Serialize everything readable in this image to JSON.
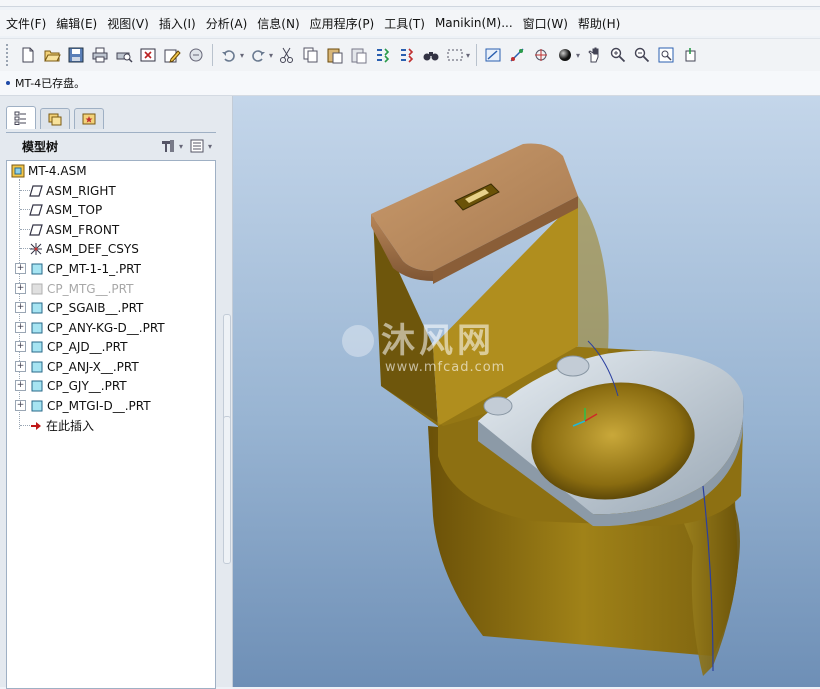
{
  "menubar": {
    "items": [
      "文件(F)",
      "编辑(E)",
      "视图(V)",
      "插入(I)",
      "分析(A)",
      "信息(N)",
      "应用程序(P)",
      "工具(T)",
      "Manikin(M)...",
      "窗口(W)",
      "帮助(H)"
    ]
  },
  "status": {
    "message": "MT-4已存盘。"
  },
  "model_tree": {
    "title": "模型树",
    "root": "MT-4.ASM",
    "items": [
      {
        "label": "ASM_RIGHT",
        "icon": "datum-plane-icon"
      },
      {
        "label": "ASM_TOP",
        "icon": "datum-plane-icon"
      },
      {
        "label": "ASM_FRONT",
        "icon": "datum-plane-icon"
      },
      {
        "label": "ASM_DEF_CSYS",
        "icon": "coordinate-system-icon"
      },
      {
        "label": "CP_MT-1-1_.PRT",
        "icon": "part-icon"
      },
      {
        "label": "CP_MTG__.PRT",
        "icon": "part-icon",
        "suppressed": true
      },
      {
        "label": "CP_SGAIB__.PRT",
        "icon": "part-icon"
      },
      {
        "label": "CP_ANY-KG-D__.PRT",
        "icon": "part-icon"
      },
      {
        "label": "CP_AJD__.PRT",
        "icon": "part-icon"
      },
      {
        "label": "CP_ANJ-X__.PRT",
        "icon": "part-icon"
      },
      {
        "label": "CP_GJY__.PRT",
        "icon": "part-icon"
      },
      {
        "label": "CP_MTGI-D__.PRT",
        "icon": "part-icon"
      },
      {
        "label": "在此插入",
        "icon": "insert-here-arrow-icon"
      }
    ]
  },
  "viewport": {
    "watermark": {
      "main": "沐风网",
      "sub": "www.mfcad.com"
    }
  },
  "colors": {
    "tank_lid": "#b9895e",
    "body": "#8a6d12",
    "seat": "#c9d3dc",
    "viewport_top": "#c4d6ea",
    "viewport_bottom": "#6e8fb6"
  }
}
